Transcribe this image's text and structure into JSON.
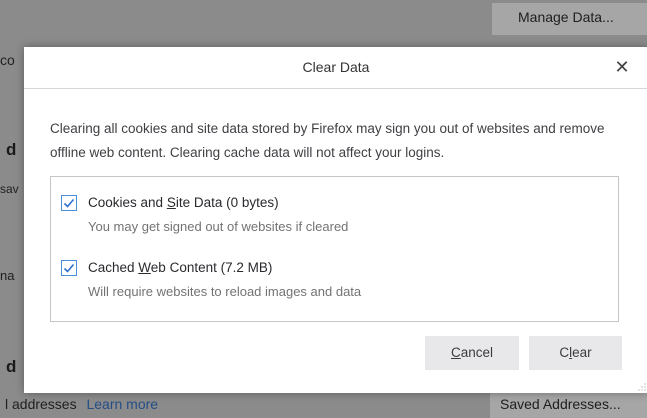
{
  "background": {
    "manage_data_button": "Manage Data...",
    "saved_addresses_button": "Saved Addresses...",
    "partial_text_left1": "co",
    "partial_heading1": "d",
    "partial_text_sav": "sav",
    "partial_text_na": "na",
    "partial_heading2": "d",
    "addresses_text": "l addresses",
    "learn_more_link": "Learn more"
  },
  "dialog": {
    "title": "Clear Data",
    "close_glyph": "✕",
    "description": "Clearing all cookies and site data stored by Firefox may sign you out of websites and remove offline web content. Clearing cache data will not affect your logins.",
    "options": [
      {
        "label_pre": "Cookies and ",
        "label_accel": "S",
        "label_post": "ite Data (0 bytes)",
        "description": "You may get signed out of websites if cleared",
        "checked": true
      },
      {
        "label_pre": "Cached ",
        "label_accel": "W",
        "label_post": "eb Content (7.2 MB)",
        "description": "Will require websites to reload images and data",
        "checked": true
      }
    ],
    "cancel_accel": "C",
    "cancel_rest": "ancel",
    "clear_pre": "C",
    "clear_accel": "l",
    "clear_post": "ear"
  },
  "colors": {
    "accent": "#0a84ff",
    "overlay": "#8b8b8b"
  }
}
